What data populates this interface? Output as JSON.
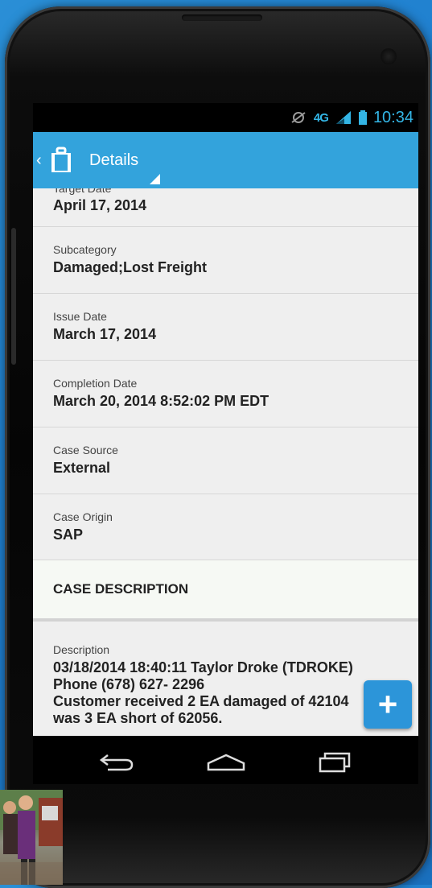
{
  "status_bar": {
    "network": "4G",
    "time": "10:34"
  },
  "action_bar": {
    "title": "Details"
  },
  "fields": [
    {
      "label": "Target Date",
      "value": "April 17, 2014"
    },
    {
      "label": "Subcategory",
      "value": "Damaged;Lost Freight"
    },
    {
      "label": "Issue Date",
      "value": "March 17, 2014"
    },
    {
      "label": "Completion Date",
      "value": "March 20, 2014 8:52:02 PM EDT"
    },
    {
      "label": "Case Source",
      "value": "External"
    },
    {
      "label": "Case Origin",
      "value": "SAP"
    }
  ],
  "section": {
    "title": "CASE DESCRIPTION"
  },
  "description": {
    "label": "Description",
    "lines": [
      "03/18/2014 18:40:11 Taylor Droke (TDROKE)",
      "Phone (678) 627- 2296",
      "Customer received 2 EA damaged of 42104",
      "was 3 EA short of 62056."
    ]
  },
  "fab": {
    "label": "+"
  },
  "colors": {
    "accent": "#33a3dc",
    "status_blue": "#33b5e5",
    "content_bg": "#efefef"
  }
}
